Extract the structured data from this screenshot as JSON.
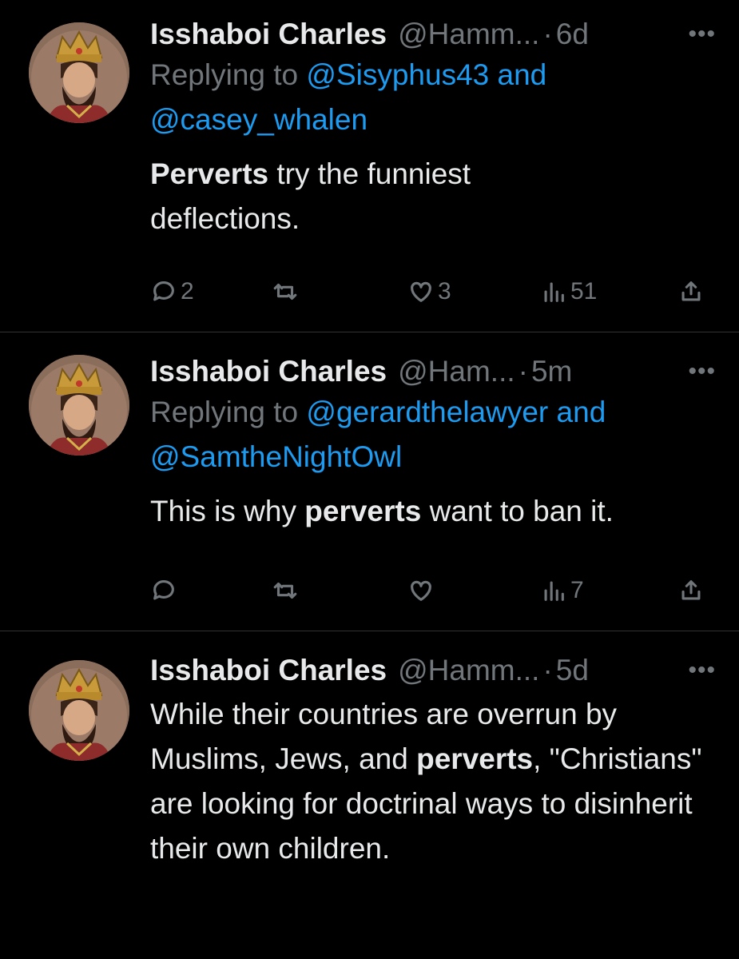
{
  "tweets": [
    {
      "name": "Isshaboi Charles",
      "handle": "@Hamm...",
      "dot": "·",
      "time": "6d",
      "more": "•••",
      "reply_prefix": "Replying to",
      "reply_mention_1": "@Sisyphus43",
      "reply_and": "and",
      "reply_mention_2": "@casey_whalen",
      "text_bold": "Perverts",
      "text_rest": " try the funniest deflections.",
      "replies": "2",
      "retweets": "",
      "likes": "3",
      "views": "51"
    },
    {
      "name": "Isshaboi Charles",
      "handle": "@Ham...",
      "dot": "·",
      "time": "5m",
      "more": "•••",
      "reply_prefix": "Replying to",
      "reply_mention_1": "@gerardthelawyer",
      "reply_and": "and",
      "reply_mention_2": "@SamtheNightOwl",
      "text_pre": "This is why ",
      "text_bold": "perverts",
      "text_post": " want to ban it.",
      "replies": "",
      "retweets": "",
      "likes": "",
      "views": "7"
    },
    {
      "name": "Isshaboi Charles",
      "handle": "@Hamm...",
      "dot": "·",
      "time": "5d",
      "more": "•••",
      "text_pre": "While their countries are overrun by Muslims, Jews, and ",
      "text_bold": "perverts",
      "text_post": ", \"Christians\" are looking for doctrinal ways to disinherit their own children."
    }
  ],
  "icons": {
    "reply": "reply-icon",
    "retweet": "retweet-icon",
    "like": "heart-icon",
    "views": "views-icon",
    "share": "share-icon",
    "more": "more-icon"
  }
}
